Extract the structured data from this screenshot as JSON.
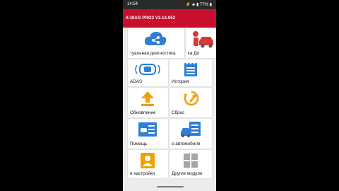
{
  "status_bar": {
    "time": "14:54",
    "indicators": "⚡ ◈ ▮ 77% ▮"
  },
  "app": {
    "title": "X-DIAG PRO3 V3.14.052",
    "accent_color": "#c8102e"
  },
  "menu": [
    {
      "label": "туальная диагностика",
      "icon": "cloud-diagnostics-icon"
    },
    {
      "label": "ка   Ди",
      "icon": "mechanic-car-icon"
    },
    {
      "label": "ADAS",
      "icon": "adas-car-icon"
    },
    {
      "label": "История",
      "icon": "history-list-icon"
    },
    {
      "label": "Обновление",
      "icon": "upload-arrow-icon"
    },
    {
      "label": "Сброс",
      "icon": "reset-wrench-icon"
    },
    {
      "label": "Помощь",
      "icon": "help-card-icon"
    },
    {
      "label": "о автомобиля",
      "icon": "vehicle-info-icon"
    },
    {
      "label": "и настройки",
      "icon": "user-settings-icon"
    },
    {
      "label": "Другие модули",
      "icon": "other-modules-icon"
    }
  ]
}
